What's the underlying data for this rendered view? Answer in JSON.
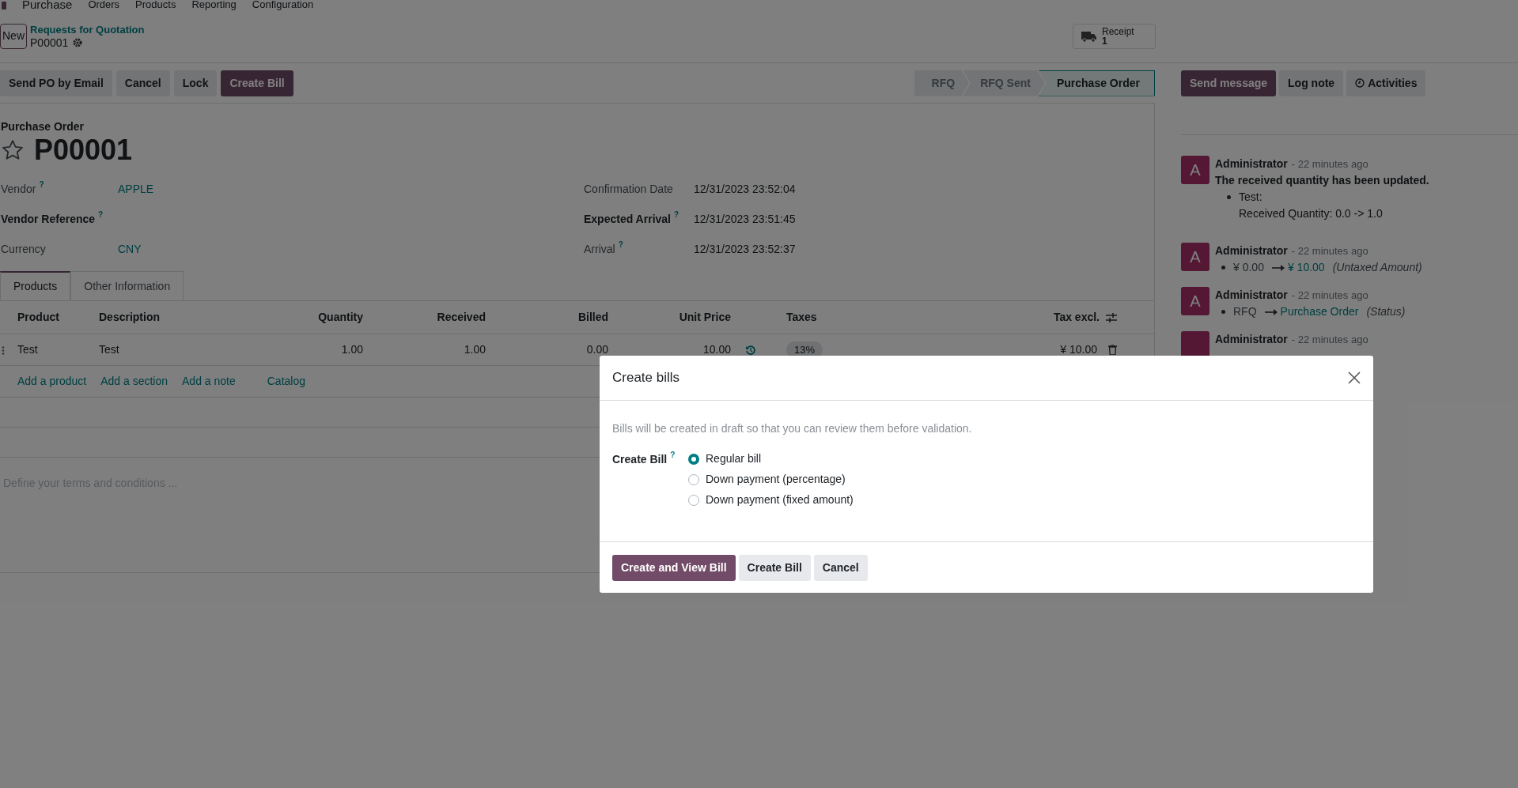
{
  "navbar": {
    "app": "Purchase",
    "menus": [
      "Orders",
      "Products",
      "Reporting",
      "Configuration"
    ]
  },
  "breadcrumb": {
    "new_button": "New",
    "parent": "Requests for Quotation",
    "current": "P00001"
  },
  "smart_button": {
    "label": "Receipt",
    "count": "1"
  },
  "actions": [
    {
      "label": "Send PO by Email",
      "primary": false
    },
    {
      "label": "Cancel",
      "primary": false
    },
    {
      "label": "Lock",
      "primary": false
    },
    {
      "label": "Create Bill",
      "primary": true
    }
  ],
  "statusbar": [
    {
      "label": "RFQ",
      "selected": false
    },
    {
      "label": "RFQ Sent",
      "selected": false
    },
    {
      "label": "Purchase Order",
      "selected": true
    }
  ],
  "form": {
    "title_label": "Purchase Order",
    "name": "P00001",
    "starred": false,
    "left_fields": [
      {
        "label": "Vendor",
        "help": "?",
        "required": false,
        "value": "APPLE",
        "link": true
      },
      {
        "label": "Vendor Reference",
        "help": "?",
        "required": true
      },
      {
        "label": "Currency",
        "required": false,
        "value": "CNY",
        "link": true
      }
    ],
    "right_fields": [
      {
        "label": "Confirmation Date",
        "required": false,
        "value": "12/31/2023 23:52:04",
        "link": false
      },
      {
        "label": "Expected Arrival",
        "help": "?",
        "required": true,
        "value": "12/31/2023 23:51:45",
        "link": false
      },
      {
        "label": "Arrival",
        "help": "?",
        "required": false,
        "value": "12/31/2023 23:52:37",
        "link": false
      }
    ]
  },
  "tabs": [
    {
      "label": "Products",
      "selected": true
    },
    {
      "label": "Other Information",
      "selected": false
    }
  ],
  "table": {
    "columns": [
      "Product",
      "Description",
      "Quantity",
      "Received",
      "Billed",
      "Unit Price",
      "Taxes",
      "Tax excl."
    ],
    "rows": [
      {
        "product": "Test",
        "description": "Test",
        "quantity": "1.00",
        "received": "1.00",
        "billed": "0.00",
        "unit_price": "10.00",
        "taxes": "13%",
        "subtotal": "¥ 10.00"
      }
    ],
    "add_links": [
      "Add a product",
      "Add a section",
      "Add a note",
      "Catalog"
    ]
  },
  "terms_placeholder": "Define your terms and conditions ...",
  "chatter": {
    "buttons": [
      {
        "label": "Send message",
        "primary": true
      },
      {
        "label": "Log note",
        "primary": false
      },
      {
        "label": "Activities",
        "primary": false
      }
    ],
    "messages": [
      {
        "kind": "text",
        "avatar": "A",
        "author": "Administrator",
        "time": "- 22 minutes ago",
        "body": "The received quantity has been updated.",
        "items": [
          {
            "label": "Test:",
            "detail": "Received Quantity: 0.0 -> 1.0"
          }
        ]
      },
      {
        "kind": "tracking",
        "avatar": "A",
        "author": "Administrator",
        "time": "- 22 minutes ago",
        "old": "¥ 0.00",
        "new": "¥ 10.00",
        "field": "(Untaxed Amount)"
      },
      {
        "kind": "tracking",
        "avatar": "A",
        "author": "Administrator",
        "time": "- 22 minutes ago",
        "old": "RFQ",
        "new": "Purchase Order",
        "field": "(Status)"
      },
      {
        "kind": "header",
        "author": "Administrator",
        "time": "- 22 minutes ago"
      }
    ]
  },
  "dialog": {
    "title": "Create bills",
    "description": "Bills will be created in draft so that you can review them before validation.",
    "field_label": "Create Bill",
    "help": "?",
    "options": [
      {
        "label": "Regular bill",
        "selected": true
      },
      {
        "label": "Down payment (percentage)",
        "selected": false
      },
      {
        "label": "Down payment (fixed amount)",
        "selected": false
      }
    ],
    "buttons": [
      {
        "label": "Create and View Bill",
        "primary": true
      },
      {
        "label": "Create Bill",
        "primary": false
      },
      {
        "label": "Cancel",
        "primary": false
      }
    ]
  }
}
